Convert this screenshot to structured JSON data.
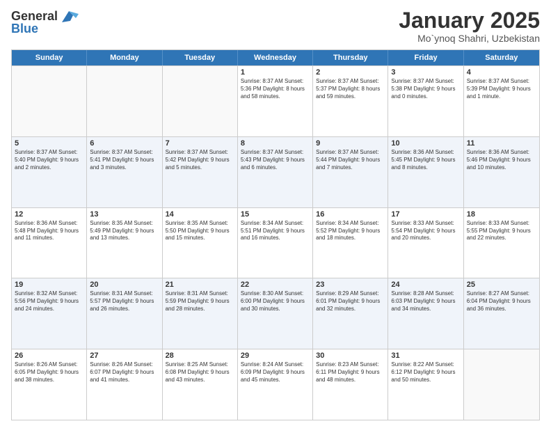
{
  "logo": {
    "line1": "General",
    "line2": "Blue"
  },
  "title": "January 2025",
  "subtitle": "Mo`ynoq Shahri, Uzbekistan",
  "header_days": [
    "Sunday",
    "Monday",
    "Tuesday",
    "Wednesday",
    "Thursday",
    "Friday",
    "Saturday"
  ],
  "weeks": [
    [
      {
        "day": "",
        "info": ""
      },
      {
        "day": "",
        "info": ""
      },
      {
        "day": "",
        "info": ""
      },
      {
        "day": "1",
        "info": "Sunrise: 8:37 AM\nSunset: 5:36 PM\nDaylight: 8 hours\nand 58 minutes."
      },
      {
        "day": "2",
        "info": "Sunrise: 8:37 AM\nSunset: 5:37 PM\nDaylight: 8 hours\nand 59 minutes."
      },
      {
        "day": "3",
        "info": "Sunrise: 8:37 AM\nSunset: 5:38 PM\nDaylight: 9 hours\nand 0 minutes."
      },
      {
        "day": "4",
        "info": "Sunrise: 8:37 AM\nSunset: 5:39 PM\nDaylight: 9 hours\nand 1 minute."
      }
    ],
    [
      {
        "day": "5",
        "info": "Sunrise: 8:37 AM\nSunset: 5:40 PM\nDaylight: 9 hours\nand 2 minutes."
      },
      {
        "day": "6",
        "info": "Sunrise: 8:37 AM\nSunset: 5:41 PM\nDaylight: 9 hours\nand 3 minutes."
      },
      {
        "day": "7",
        "info": "Sunrise: 8:37 AM\nSunset: 5:42 PM\nDaylight: 9 hours\nand 5 minutes."
      },
      {
        "day": "8",
        "info": "Sunrise: 8:37 AM\nSunset: 5:43 PM\nDaylight: 9 hours\nand 6 minutes."
      },
      {
        "day": "9",
        "info": "Sunrise: 8:37 AM\nSunset: 5:44 PM\nDaylight: 9 hours\nand 7 minutes."
      },
      {
        "day": "10",
        "info": "Sunrise: 8:36 AM\nSunset: 5:45 PM\nDaylight: 9 hours\nand 8 minutes."
      },
      {
        "day": "11",
        "info": "Sunrise: 8:36 AM\nSunset: 5:46 PM\nDaylight: 9 hours\nand 10 minutes."
      }
    ],
    [
      {
        "day": "12",
        "info": "Sunrise: 8:36 AM\nSunset: 5:48 PM\nDaylight: 9 hours\nand 11 minutes."
      },
      {
        "day": "13",
        "info": "Sunrise: 8:35 AM\nSunset: 5:49 PM\nDaylight: 9 hours\nand 13 minutes."
      },
      {
        "day": "14",
        "info": "Sunrise: 8:35 AM\nSunset: 5:50 PM\nDaylight: 9 hours\nand 15 minutes."
      },
      {
        "day": "15",
        "info": "Sunrise: 8:34 AM\nSunset: 5:51 PM\nDaylight: 9 hours\nand 16 minutes."
      },
      {
        "day": "16",
        "info": "Sunrise: 8:34 AM\nSunset: 5:52 PM\nDaylight: 9 hours\nand 18 minutes."
      },
      {
        "day": "17",
        "info": "Sunrise: 8:33 AM\nSunset: 5:54 PM\nDaylight: 9 hours\nand 20 minutes."
      },
      {
        "day": "18",
        "info": "Sunrise: 8:33 AM\nSunset: 5:55 PM\nDaylight: 9 hours\nand 22 minutes."
      }
    ],
    [
      {
        "day": "19",
        "info": "Sunrise: 8:32 AM\nSunset: 5:56 PM\nDaylight: 9 hours\nand 24 minutes."
      },
      {
        "day": "20",
        "info": "Sunrise: 8:31 AM\nSunset: 5:57 PM\nDaylight: 9 hours\nand 26 minutes."
      },
      {
        "day": "21",
        "info": "Sunrise: 8:31 AM\nSunset: 5:59 PM\nDaylight: 9 hours\nand 28 minutes."
      },
      {
        "day": "22",
        "info": "Sunrise: 8:30 AM\nSunset: 6:00 PM\nDaylight: 9 hours\nand 30 minutes."
      },
      {
        "day": "23",
        "info": "Sunrise: 8:29 AM\nSunset: 6:01 PM\nDaylight: 9 hours\nand 32 minutes."
      },
      {
        "day": "24",
        "info": "Sunrise: 8:28 AM\nSunset: 6:03 PM\nDaylight: 9 hours\nand 34 minutes."
      },
      {
        "day": "25",
        "info": "Sunrise: 8:27 AM\nSunset: 6:04 PM\nDaylight: 9 hours\nand 36 minutes."
      }
    ],
    [
      {
        "day": "26",
        "info": "Sunrise: 8:26 AM\nSunset: 6:05 PM\nDaylight: 9 hours\nand 38 minutes."
      },
      {
        "day": "27",
        "info": "Sunrise: 8:26 AM\nSunset: 6:07 PM\nDaylight: 9 hours\nand 41 minutes."
      },
      {
        "day": "28",
        "info": "Sunrise: 8:25 AM\nSunset: 6:08 PM\nDaylight: 9 hours\nand 43 minutes."
      },
      {
        "day": "29",
        "info": "Sunrise: 8:24 AM\nSunset: 6:09 PM\nDaylight: 9 hours\nand 45 minutes."
      },
      {
        "day": "30",
        "info": "Sunrise: 8:23 AM\nSunset: 6:11 PM\nDaylight: 9 hours\nand 48 minutes."
      },
      {
        "day": "31",
        "info": "Sunrise: 8:22 AM\nSunset: 6:12 PM\nDaylight: 9 hours\nand 50 minutes."
      },
      {
        "day": "",
        "info": ""
      }
    ]
  ]
}
